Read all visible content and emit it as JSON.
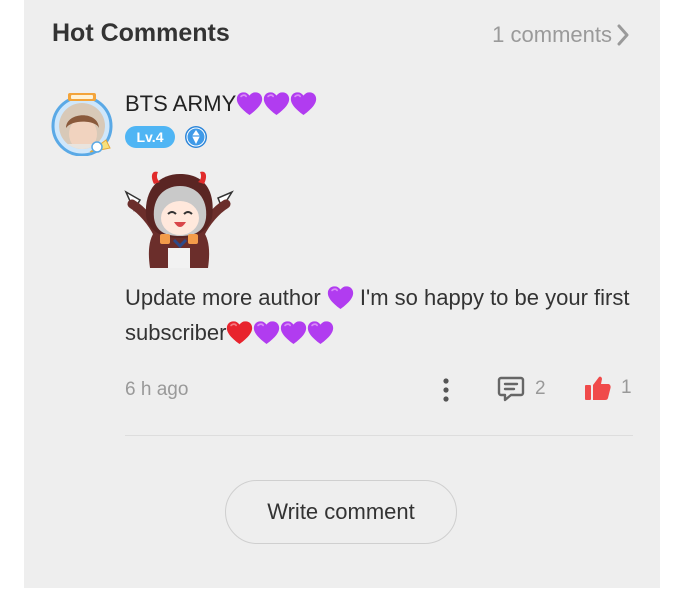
{
  "header": {
    "title": "Hot Comments",
    "count_label": "1 comments"
  },
  "comment": {
    "username": "BTS ARMY",
    "username_emoji": "purple-heart-x3",
    "level": "Lv.4",
    "text_part1": "Update more author",
    "text_part2": "I'm so happy to be your first subscriber",
    "time": "6 h ago",
    "reply_count": "2",
    "like_count": "1"
  },
  "actions": {
    "write_comment": "Write comment"
  },
  "colors": {
    "panel_bg": "#eeeeee",
    "level_badge": "#4fb5f4",
    "like_red": "#f04a4a",
    "purple_heart": "#b13cf0",
    "red_heart": "#e8232d"
  },
  "icons": [
    "chevron-right-icon",
    "more-vertical-icon",
    "comment-icon",
    "thumbs-up-icon",
    "diamond-badge-icon"
  ]
}
